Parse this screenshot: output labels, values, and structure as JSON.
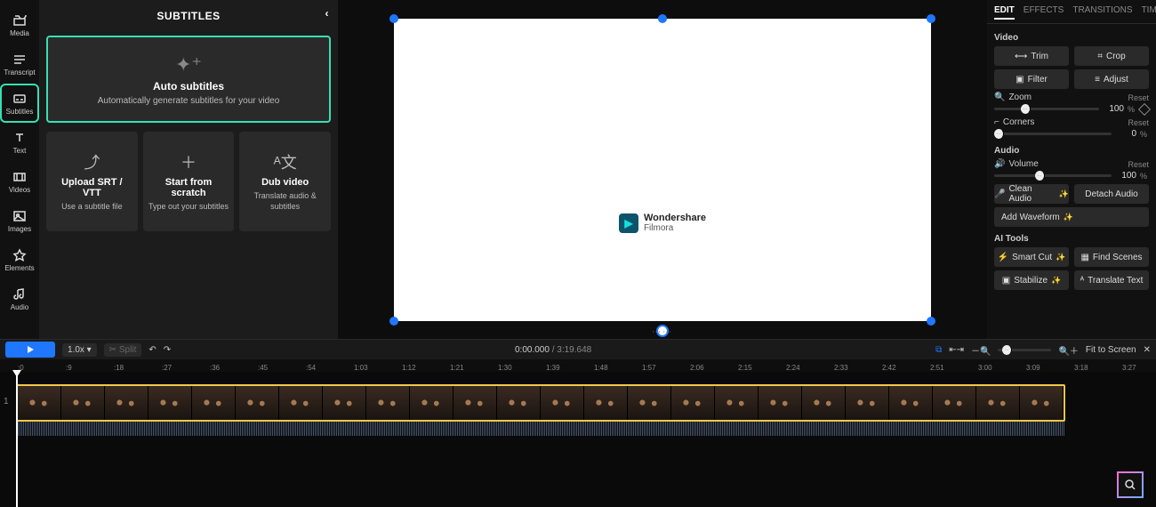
{
  "rail": {
    "items": [
      {
        "id": "media",
        "label": "Media"
      },
      {
        "id": "transcript",
        "label": "Transcript"
      },
      {
        "id": "subtitles",
        "label": "Subtitles",
        "active": true
      },
      {
        "id": "text",
        "label": "Text"
      },
      {
        "id": "videos",
        "label": "Videos"
      },
      {
        "id": "images",
        "label": "Images"
      },
      {
        "id": "elements",
        "label": "Elements"
      },
      {
        "id": "audio",
        "label": "Audio"
      }
    ]
  },
  "subtitles_panel": {
    "header": "SUBTITLES",
    "auto": {
      "title": "Auto subtitles",
      "desc": "Automatically generate subtitles for your video"
    },
    "cards": [
      {
        "id": "upload",
        "title": "Upload SRT / VTT",
        "desc": "Use a subtitle file",
        "icon": "upload-icon"
      },
      {
        "id": "scratch",
        "title": "Start from scratch",
        "desc": "Type out your subtitles",
        "icon": "plus-icon"
      },
      {
        "id": "dub",
        "title": "Dub video",
        "desc": "Translate audio & subtitles",
        "icon": "translate-icon"
      }
    ]
  },
  "preview": {
    "logo_brand": "Wondershare",
    "logo_product": "Filmora"
  },
  "edit_panel": {
    "tabs": [
      "EDIT",
      "EFFECTS",
      "TRANSITIONS",
      "TIMING"
    ],
    "active_tab": "EDIT",
    "video_label": "Video",
    "trim": "Trim",
    "crop": "Crop",
    "filter": "Filter",
    "adjust": "Adjust",
    "zoom": {
      "label": "Zoom",
      "reset": "Reset",
      "value": "100",
      "unit": "%"
    },
    "corners": {
      "label": "Corners",
      "reset": "Reset",
      "value": "0",
      "unit": "%"
    },
    "audio_label": "Audio",
    "volume": {
      "label": "Volume",
      "reset": "Reset",
      "value": "100",
      "unit": "%"
    },
    "clean_audio": "Clean Audio",
    "detach_audio": "Detach Audio",
    "add_waveform": "Add Waveform",
    "ai_label": "AI Tools",
    "smart_cut": "Smart Cut",
    "find_scenes": "Find Scenes",
    "stabilize": "Stabilize",
    "translate_text": "Translate Text"
  },
  "toolbar": {
    "speed": "1.0x",
    "split": "Split",
    "current_time": "0:00.000",
    "duration": "3:19.648",
    "fit": "Fit to Screen",
    "ruler_ticks": [
      ":0",
      ":9",
      ":18",
      ":27",
      ":36",
      ":45",
      ":54",
      "1:03",
      "1:12",
      "1:21",
      "1:30",
      "1:39",
      "1:48",
      "1:57",
      "2:06",
      "2:15",
      "2:24",
      "2:33",
      "2:42",
      "2:51",
      "3:00",
      "3:09",
      "3:18",
      "3:27"
    ]
  },
  "timeline": {
    "track": "1",
    "thumb_count": 24
  }
}
